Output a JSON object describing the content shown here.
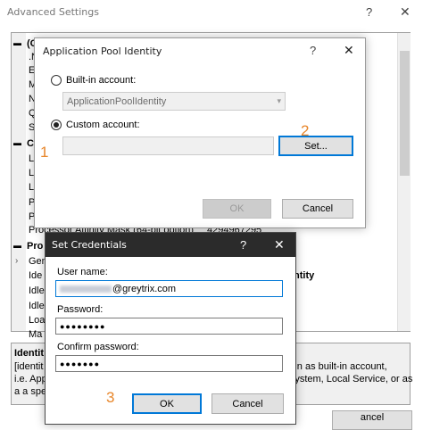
{
  "advanced_settings": {
    "title": "Advanced Settings",
    "help": "?",
    "close": "✕",
    "rows": [
      {
        "label": "(G"
      },
      {
        "label": ".N"
      },
      {
        "label": "E"
      },
      {
        "label": "M"
      },
      {
        "label": "N"
      },
      {
        "label": "Q"
      },
      {
        "label": "S"
      },
      {
        "label": "C"
      },
      {
        "label": "Li"
      },
      {
        "label": "Li"
      },
      {
        "label": "Li"
      },
      {
        "label": "P"
      },
      {
        "label": "P"
      }
    ],
    "processor_row": {
      "label": "Processor Affinity Mask (64-bit option)",
      "value": "4294967295"
    },
    "section_process": "Pro",
    "lower_rows": [
      {
        "label": "Gen"
      },
      {
        "label": "Ide"
      },
      {
        "label": "Idle"
      },
      {
        "label": "Idle"
      },
      {
        "label": "Loa"
      },
      {
        "label": "Ma"
      }
    ],
    "identity_fragment": "ntity",
    "desc_title": "Identit",
    "desc_line1_left": "[identit",
    "desc_line1_right": "run as built-in account,",
    "desc_line2_left": "i.e. App",
    "desc_line2_right": "System, Local Service, or as",
    "desc_line3_left": "a a specif",
    "cancel_fragment": "ancel"
  },
  "app_pool_identity": {
    "title": "Application Pool Identity",
    "help": "?",
    "close": "✕",
    "builtin_label": "Built-in account:",
    "builtin_value": "ApplicationPoolIdentity",
    "custom_label": "Custom account:",
    "custom_value": "",
    "set_button": "Set...",
    "ok_button": "OK",
    "cancel_button": "Cancel"
  },
  "set_credentials": {
    "title": "Set Credentials",
    "help": "?",
    "close": "✕",
    "username_label": "User name:",
    "username_value": "@greytrix.com",
    "password_label": "Password:",
    "password_value": "●●●●●●●●",
    "confirm_label": "Confirm password:",
    "confirm_value": "●●●●●●●",
    "ok_button": "OK",
    "cancel_button": "Cancel"
  },
  "callouts": {
    "one": "1",
    "two": "2",
    "three": "3"
  }
}
